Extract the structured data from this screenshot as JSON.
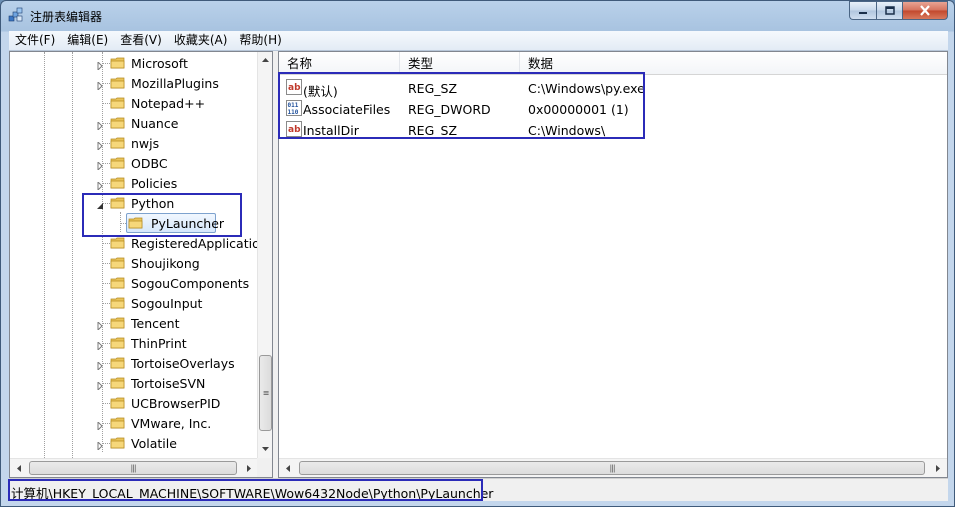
{
  "window": {
    "title": "注册表编辑器",
    "icon": "regedit-icon"
  },
  "menu": [
    {
      "label": "文件(F)"
    },
    {
      "label": "编辑(E)"
    },
    {
      "label": "查看(V)"
    },
    {
      "label": "收藏夹(A)"
    },
    {
      "label": "帮助(H)"
    }
  ],
  "tree": {
    "items": [
      {
        "label": "Microsoft",
        "expander": "collapsed"
      },
      {
        "label": "MozillaPlugins",
        "expander": "collapsed"
      },
      {
        "label": "Notepad++",
        "expander": "none"
      },
      {
        "label": "Nuance",
        "expander": "collapsed"
      },
      {
        "label": "nwjs",
        "expander": "collapsed"
      },
      {
        "label": "ODBC",
        "expander": "collapsed"
      },
      {
        "label": "Policies",
        "expander": "collapsed"
      },
      {
        "label": "Python",
        "expander": "expanded"
      },
      {
        "label": "PyLauncher",
        "expander": "none",
        "child": true,
        "selected": true
      },
      {
        "label": "RegisteredApplications",
        "expander": "none"
      },
      {
        "label": "Shoujikong",
        "expander": "none"
      },
      {
        "label": "SogouComponents",
        "expander": "none"
      },
      {
        "label": "SogouInput",
        "expander": "none"
      },
      {
        "label": "Tencent",
        "expander": "collapsed"
      },
      {
        "label": "ThinPrint",
        "expander": "collapsed"
      },
      {
        "label": "TortoiseOverlays",
        "expander": "collapsed"
      },
      {
        "label": "TortoiseSVN",
        "expander": "collapsed"
      },
      {
        "label": "UCBrowserPID",
        "expander": "none"
      },
      {
        "label": "VMware, Inc.",
        "expander": "collapsed"
      },
      {
        "label": "Volatile",
        "expander": "collapsed"
      }
    ]
  },
  "list": {
    "columns": [
      "名称",
      "类型",
      "数据"
    ],
    "rows": [
      {
        "name": "(默认)",
        "type": "REG_SZ",
        "data": "C:\\Windows\\py.exe",
        "icon": "string-value-icon"
      },
      {
        "name": "AssociateFiles",
        "type": "REG_DWORD",
        "data": "0x00000001 (1)",
        "icon": "dword-value-icon"
      },
      {
        "name": "InstallDir",
        "type": "REG_SZ",
        "data": "C:\\Windows\\",
        "icon": "string-value-icon"
      }
    ]
  },
  "statusbar": {
    "path": "计算机\\HKEY_LOCAL_MACHINE\\SOFTWARE\\Wow6432Node\\Python\\PyLauncher"
  },
  "colors": {
    "highlight_box": "#2b2bb8",
    "selection_border": "#7da2ce",
    "folder": "#e8c35a"
  }
}
